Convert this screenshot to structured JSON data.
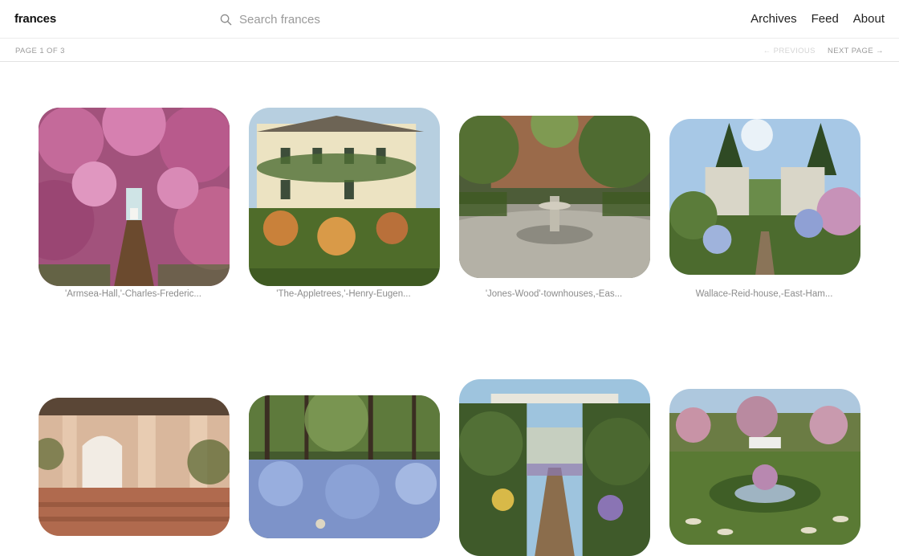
{
  "header": {
    "brand": "frances",
    "search_placeholder": "Search frances",
    "nav": [
      "Archives",
      "Feed",
      "About"
    ]
  },
  "pagination": {
    "page_info": "PAGE 1 OF 3",
    "previous_label": "← PREVIOUS",
    "next_label": "NEXT PAGE →"
  },
  "photos": [
    {
      "caption": "'Armsea-Hall,'-Charles-Frederic..."
    },
    {
      "caption": "'The-Appletrees,'-Henry-Eugen..."
    },
    {
      "caption": "'Jones-Wood'-townhouses,-Eas..."
    },
    {
      "caption": "Wallace-Reid-house,-East-Ham..."
    },
    {
      "caption": ""
    },
    {
      "caption": ""
    },
    {
      "caption": ""
    },
    {
      "caption": ""
    }
  ],
  "colors": {
    "text_muted": "#8c8c8c",
    "divider": "#ececec"
  }
}
